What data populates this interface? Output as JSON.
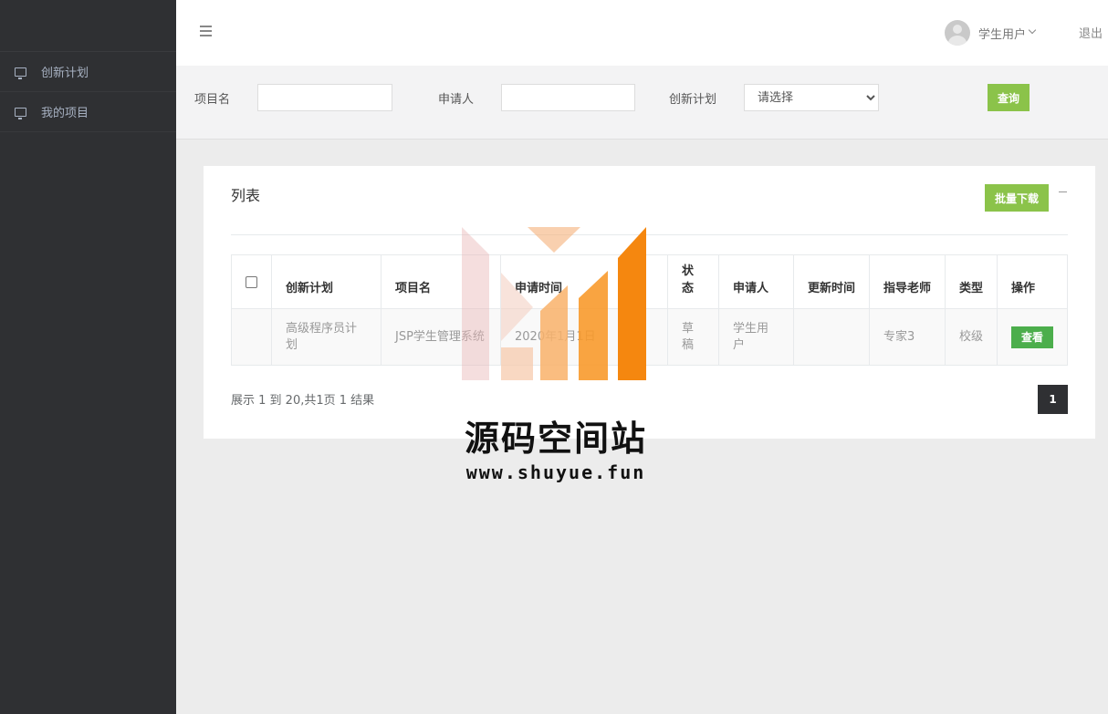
{
  "sidebar": {
    "items": [
      {
        "label": "创新计划",
        "icon": "monitor-icon"
      },
      {
        "label": "我的项目",
        "icon": "monitor-icon"
      }
    ]
  },
  "topbar": {
    "menu_icon": "hamburger-icon",
    "user_name": "学生用户",
    "logout": "退出"
  },
  "search": {
    "project_label": "项目名",
    "project_value": "",
    "applicant_label": "申请人",
    "applicant_value": "",
    "plan_label": "创新计划",
    "plan_selected": "请选择",
    "search_button": "查询"
  },
  "panel": {
    "title": "列表",
    "batch_download": "批量下载",
    "columns": [
      "创新计划",
      "项目名",
      "申请时间",
      "状态",
      "申请人",
      "更新时间",
      "指导老师",
      "类型",
      "操作"
    ],
    "rows": [
      {
        "plan": "高级程序员计划",
        "project": "JSP学生管理系统",
        "apply_time": "2020年1月1日",
        "status": "草稿",
        "applicant": "学生用户",
        "update_time": "",
        "teacher": "专家3",
        "type": "校级",
        "action": "查看"
      }
    ],
    "pagination_info": "展示 1 到 20,共1页 1 结果",
    "current_page": "1"
  },
  "watermark": {
    "text": "源码空间站",
    "url": "www.shuyue.fun"
  },
  "colors": {
    "sidebar_bg": "#2f3033",
    "accent_green": "#8bc34a",
    "action_green": "#4cae4c",
    "page_bg": "#ececec"
  }
}
